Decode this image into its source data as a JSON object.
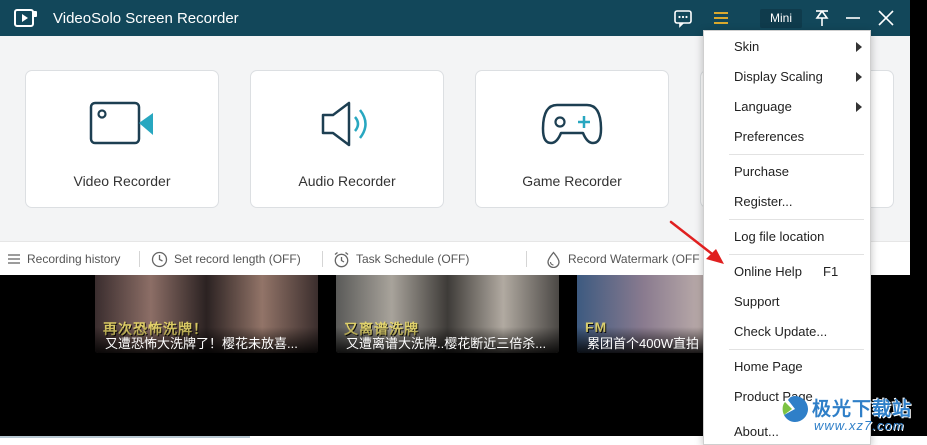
{
  "app": {
    "title": "VideoSolo Screen Recorder",
    "mini_label": "Mini"
  },
  "colors": {
    "titlebar": "#12475a",
    "accent": "#1a6f8a",
    "arrow": "#e02020"
  },
  "cards": [
    {
      "label": "Video Recorder",
      "icon": "video-camera-icon"
    },
    {
      "label": "Audio Recorder",
      "icon": "speaker-icon"
    },
    {
      "label": "Game Recorder",
      "icon": "gamepad-icon"
    }
  ],
  "toolbar": {
    "history": "Recording history",
    "record_length": "Set record length (OFF)",
    "task_schedule": "Task Schedule (OFF)",
    "watermark": "Record Watermark (OFF"
  },
  "videos": [
    {
      "overlay": "再次恐怖洗牌！",
      "caption": "又遭恐怖大洗牌了！樱花未放喜..."
    },
    {
      "overlay": "又离谱洗牌",
      "caption": "又遭离谱大洗牌..樱花断近三倍杀..."
    },
    {
      "overlay": "FM",
      "caption": "累团首个400W直拍"
    }
  ],
  "menu": {
    "skin": "Skin",
    "display_scaling": "Display Scaling",
    "language": "Language",
    "preferences": "Preferences",
    "purchase": "Purchase",
    "register": "Register...",
    "log_location": "Log file location",
    "online_help": "Online Help",
    "online_help_shortcut": "F1",
    "support": "Support",
    "check_update": "Check Update...",
    "home_page": "Home Page",
    "product_page": "Product Page",
    "about": "About..."
  },
  "watermark": {
    "title": "极光下载站",
    "url": "www.xz7.com"
  }
}
